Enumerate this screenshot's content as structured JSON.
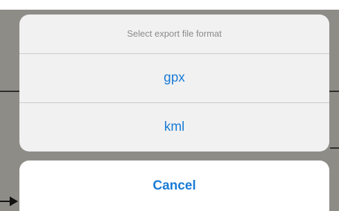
{
  "dialog": {
    "title": "Select export file format",
    "options": [
      {
        "label": "gpx"
      },
      {
        "label": "kml"
      }
    ],
    "cancel_label": "Cancel"
  },
  "colors": {
    "accent": "#1a7bd6",
    "sheet_background": "#f1f1f1",
    "backdrop": "#8e8c87",
    "title_text": "#8a8a8a"
  },
  "icons": {
    "pointer": "arrow-right-icon"
  }
}
